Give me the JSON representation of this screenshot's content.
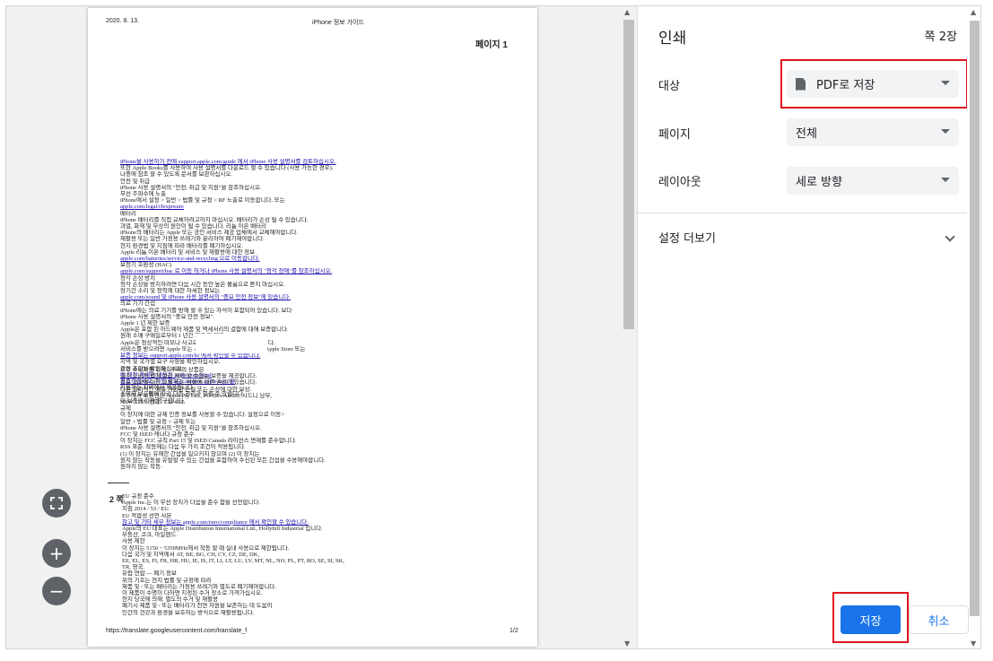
{
  "preview": {
    "header_date": "2020. 8. 13.",
    "header_title": "iPhone 정보 가이드",
    "page_heading": "페이지 1",
    "section2_marker": "2 쪽",
    "footer_url": "https://translate.googleusercontent.com/translate_f",
    "footer_page": "1/2",
    "body_lines_a": [
      "iPhone을 사용하기 전에 support.apple.com/guide 에서 iPhone 사용 설명서를 검토하십시오.",
      "또한 Apple Books를 사용하여 사용 설명서를 다운로드 할 수 있습니다 (사용 가능한 경우).",
      "나중에 참조 할 수 있도록 문서를 보관하십시오.",
      "안전 및 취급",
      "iPhone 사용 설명서의 \"안전, 취급 및 지원\"을 참조하십시오.",
      "무선 주파수에 노출",
      "iPhone에서 설정 > 일반 > 법률 및 규정 > RF 노출로 이동합니다. 또는",
      "apple.com/legal/rfexposure",
      "배터리",
      "iPhone 배터리를 직접 교체하려고하지 마십시오. 배터리가 손상 될 수 있습니다.",
      "과열, 화재 및 부상의 원인이 될 수 있습니다. 리튬 이온 배터리",
      "iPhone의 배터리는 Apple 또는 공인 서비스 제공 업체에서 교체해야합니다.",
      "재활용 또는 일반 가정용 쓰레기와 분리하여 폐기해야합니다.",
      "현지 환경법 및 지침에 따라 배터리를 폐기하십시오.",
      "Apple 리튬 이온 배터리 및 서비스 및 재활용에 대한 정보",
      "apple.com/batteries/service-and-recycling 으로 이동합니다.",
      "보청기 호환성 (HAC)",
      "apple.com/support/hac 로 이동 하거나 iPhone 사용 설명서의 \"청각 장애\"를 참조하십시오.",
      "청각 손상 방지",
      "청각 손상을 방지하려면 다음 시간 동안 높은 볼륨으로 듣지 마십시오.",
      "장기간 소리 및 청력에 대한 자세한 정보는",
      "apple.com/sound 및 iPhone 사용 설명서의 \"중요 안전 정보\"에 있습니다.",
      "의료 기기 간섭",
      "iPhone에는 의료 기기를 방해 할 수 있는 자석이 포함되어 있습니다. 보다",
      "iPhone 사용 설명서의 \"중요 안전 정보\".",
      "Apple 1 년 제한 보증",
      "Apple은 포함 된 하드웨어 제품 및 액세서리의 결함에 대해 보증합니다.",
      "원래 소매 구매일로부터 1 년간 재료 및 제작.",
      "Apple은 정상적인 마모나 사고로 인한 손상은 보증하지 않습니다.",
      "서비스를 받으려면 Apple 또는 Apple 공인 서비스 제공 업체, Apple Store 또는",
      "보증 정보는 support.apple.com/kr 에서 확인할 수 있습니다.",
      "지역 및 국가별 요구 사항을 확인하십시오.",
      "관련 조항을 확인하십시오.",
      "에 대한 자세한 내용은 apple.com/legal",
      "참조하십시오. 지원 정보는 support.apple.com 을",
      "지원하는 지역에서 제공됩니다.",
      "소비자 보호법에 따라 다른 권리가 있을 수 있습니다.",
      "이 보증에 따라 청구합니다."
    ],
    "body_lines_b": [
      "호주 소비자를 위해 : 우리의 상품은",
      "호주 소비자 법에 따라 제외 할 수없는 보증을 제공합니다.",
      "주요 고장에 대한 교체 또는 환불에 대한 권리가 있습니다.",
      "다른 합리적인 예측 가능한 손실 또는 손상에 대한 보상.",
      "호주에서 보증인은 Apple Pty Ltd., PO Box A2629, 시드니 남부,",
      "NSW 1235. 전화 : 133-622.",
      "규제",
      "이 장치에 대한 규제 인증 정보를 사용할 수 있습니다. 설정으로 이동>",
      "일반 > 법률 및 규정 > 규제 또는",
      "iPhone 사용 설명서의 \"안전, 취급 및 지원\"을 참조하십시오.",
      "FCC 및 ISED 캐나다 규정 준수",
      "이 장치는 FCC 규칙 Part 15 및 ISED Canada 라이선스 면제를 준수합니다.",
      "RSS 표준. 작동에는 다음 두 가지 조건이 적용됩니다.",
      "(1) 이 장치는 유해한 간섭을 일으키지 않으며 (2) 이 장치는",
      "원치 않는 작동을 유발할 수 있는 간섭을 포함하여 수신된 모든 간섭을 수용해야합니다.",
      "원하지 않는 작동."
    ],
    "body_lines_c": [
      "EU 규정 준수",
      "Apple Inc.는 이 무선 장치가 다음을 준수 함을 선언합니다.",
      "지침 2014 / 53 / EU.",
      "EU 적합성 선언 사본",
      "참고 및 기타 세부 정보는 apple.com/euro/compliance 에서 확인할 수 있습니다.",
      "Apple의 EU 대표는 Apple Distribution International Ltd., Hollyhill Industrial 입니다.",
      "부동산, 코크, 아일랜드.",
      "",
      "",
      "사용 제한",
      "이 장치는 5150 ~ 5350MHz에서 작동 할 때 실내 사용으로 제한됩니다.",
      "다음 국가 및 지역에서 AT, BE, BG, CH, CY, CZ, DE, DK,",
      "EE, EL, ES, FI, FR, HR, HU, IE, IS, IT, LI, LT, LU, LV, MT, NL, NO, PL, PT, RO, SE, SI, SK,",
      "TR, 영국.",
      "유럽 연합 — 폐기 정보",
      "",
      "",
      "위의 기호는 현지 법률 및 규정에 따라",
      "제품 및 / 또는 배터리는 가정용 쓰레기와 별도로 폐기해야합니다.",
      "이 제품이 수명이 다하면 지정된 수거 장소로 가져가십시오.",
      "현지 당국에 의해. 별도의 수거 및 재활용",
      "폐기시 제품 및 / 또는 배터리가 천연 자원을 보존하는 데 도움이",
      "인간의 건강과 환경을 보호하는 방식으로 재활용됩니다."
    ]
  },
  "zoom": {
    "fit_icon": "fit-to-page-icon",
    "zoom_in": "+",
    "zoom_out": "−"
  },
  "settings": {
    "title": "인쇄",
    "page_count": "쪽 2장",
    "destination_label": "대상",
    "destination_value": "PDF로 저장",
    "pages_label": "페이지",
    "pages_value": "전체",
    "layout_label": "레이아웃",
    "layout_value": "세로 방향",
    "more_settings": "설정 더보기",
    "save_button": "저장",
    "cancel_button": "취소"
  },
  "colors": {
    "accent": "#1a73e8",
    "highlight": "#e0141e",
    "zoom_button": "#5f6368"
  }
}
